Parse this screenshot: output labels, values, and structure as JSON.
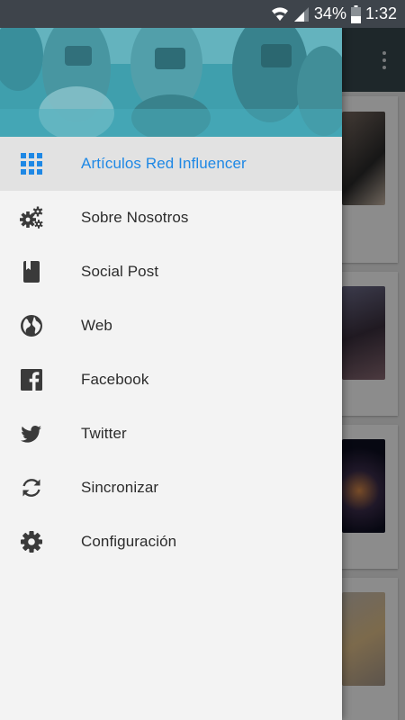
{
  "status_bar": {
    "battery_percent": "34%",
    "time": "1:32"
  },
  "colors": {
    "accent": "#1e88e5",
    "status_bar": "#3e444b",
    "app_bar": "#38474e",
    "drawer_bg": "#f3f3f3",
    "header_teal": "#3fa6b5"
  },
  "drawer": {
    "menu_items": [
      {
        "label": "Artículos Red Influencer",
        "icon": "grid-icon",
        "active": true
      },
      {
        "label": "Sobre Nosotros",
        "icon": "gears-icon",
        "active": false
      },
      {
        "label": "Social Post",
        "icon": "bookmark-book-icon",
        "active": false
      },
      {
        "label": "Web",
        "icon": "globe-icon",
        "active": false
      },
      {
        "label": "Facebook",
        "icon": "facebook-icon",
        "active": false
      },
      {
        "label": "Twitter",
        "icon": "twitter-icon",
        "active": false
      },
      {
        "label": "Sincronizar",
        "icon": "sync-icon",
        "active": false
      },
      {
        "label": "Configuración",
        "icon": "settings-gear-icon",
        "active": false
      }
    ]
  }
}
